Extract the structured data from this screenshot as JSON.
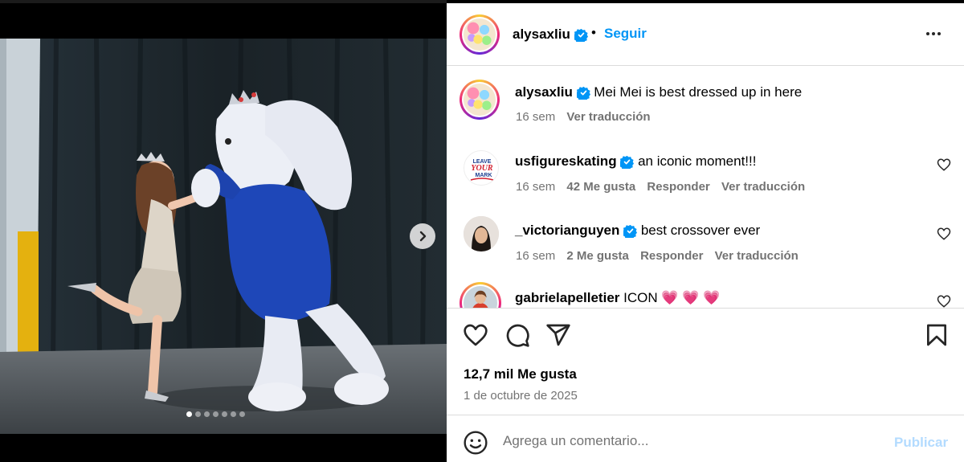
{
  "post": {
    "username": "alysaxliu",
    "follow_label": "Seguir",
    "separator": "•",
    "caption": {
      "text": "Mei Mei is best dressed up in here",
      "time": "16 sem",
      "translate": "Ver traducción"
    },
    "likes": "12,7 mil Me gusta",
    "date": "1 de octubre de 2025",
    "carousel": {
      "slide_count": 7,
      "active_index": 0
    }
  },
  "comments": [
    {
      "username": "usfigureskating",
      "verified": true,
      "text": "an iconic moment!!!",
      "time": "16 sem",
      "likes": "42 Me gusta",
      "reply": "Responder",
      "translate": "Ver traducción"
    },
    {
      "username": "_victorianguyen",
      "verified": true,
      "text": "best crossover ever",
      "time": "16 sem",
      "likes": "2 Me gusta",
      "reply": "Responder",
      "translate": "Ver traducción"
    },
    {
      "username": "gabrielapelletier",
      "verified": false,
      "text": "ICON",
      "emojis": "💗 💗 💗"
    }
  ],
  "composer": {
    "placeholder": "Agrega un comentario...",
    "publish_label": "Publicar"
  },
  "avatar_logo_text": [
    "LEAVE",
    "YOUR",
    "MARK"
  ],
  "colors": {
    "accent": "#0095f6",
    "publish_disabled": "#b3dbff",
    "verified": "#0095f6",
    "muted_text": "#737373",
    "heart_emoji": "#e8336b",
    "bunny_jacket": "#1e47b8"
  },
  "icons": {
    "next": "chevron-right-icon",
    "more": "more-horizontal-icon",
    "verified": "verified-badge-icon",
    "like": "heart-icon",
    "comment": "comment-icon",
    "share": "share-icon",
    "save": "bookmark-icon",
    "emoji": "emoji-icon"
  }
}
